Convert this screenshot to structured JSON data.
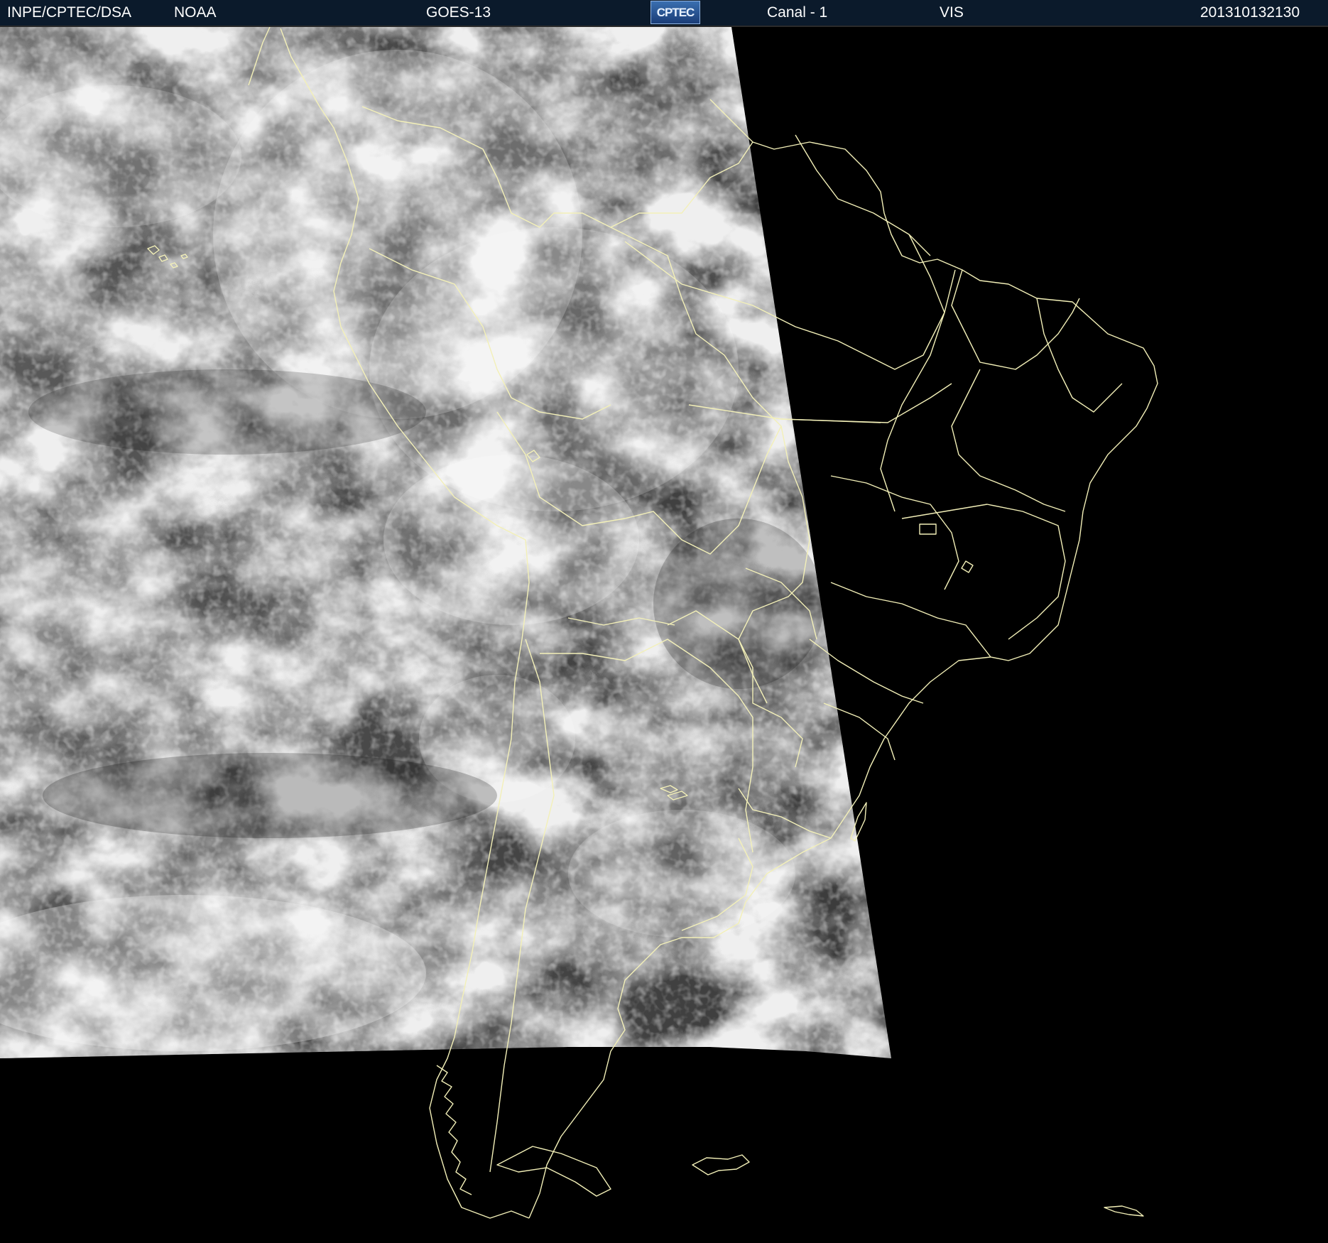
{
  "header": {
    "agency": "INPE/CPTEC/DSA",
    "partner": "NOAA",
    "satellite": "GOES-13",
    "logo_text": "CPTEC",
    "channel": "Canal - 1",
    "band": "VIS",
    "timestamp": "201310132130"
  },
  "colors": {
    "header_bg": "#0b1a2b",
    "header_text": "#ffffff",
    "boundary_line": "#f3f0b8",
    "space": "#000000",
    "cloud_bright": "#e8e8e8",
    "cloud_dark": "#3c3c3c"
  }
}
